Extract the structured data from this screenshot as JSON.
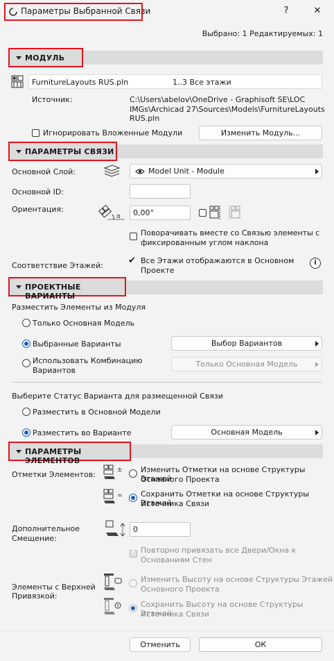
{
  "window": {
    "title": "Параметры Выбранной Связи",
    "help": "?",
    "close": "✕",
    "status": "Выбрано: 1 Редактируемых: 1"
  },
  "module": {
    "header": "МОДУЛЬ",
    "file_name": "FurnitureLayouts RUS.pln",
    "stories": "1..3 Все этажи",
    "source_label": "Источник:",
    "source_path_1": "C:\\Users\\abelov\\OneDrive - Graphisoft SE\\LOC",
    "source_path_2": "IMGs\\Archicad 27\\Sources\\Models\\FurnitureLayouts",
    "source_path_3": "RUS.pln",
    "ignore_nested": "Игнорировать Вложенные Модули",
    "change_module": "Изменить Модуль..."
  },
  "link": {
    "header": "ПАРАМЕТРЫ СВЯЗИ",
    "main_layer_label": "Основной Слой:",
    "main_layer_value": "Model Unit - Module",
    "main_id_label": "Основной ID:",
    "main_id_value": "",
    "orientation_label": "Ориентация:",
    "orientation_value": "0,00°",
    "rotate_fixed": "Поворачивать вместе со Связью элементы с",
    "rotate_fixed_2": "фиксированным углом наклона",
    "story_match_label": "Соответствие Этажей:",
    "story_match_1": "Все Этажи отображаются в Основном",
    "story_match_2": "Проекте",
    "info": "i"
  },
  "design_options": {
    "header": "ПРОЕКТНЫЕ ВАРИАНТЫ",
    "place_elements": "Разместить Элементы из Модуля",
    "only_main": "Только Основная Модель",
    "selected_options": "Выбранные Варианты",
    "select_options_btn": "Выбор Вариантов",
    "use_combination_1": "Использовать Комбинацию",
    "use_combination_2": "Вариантов",
    "combination_value": "Только Основная Модель",
    "choose_status": "Выберите Статус Варианта для размещенной Связи",
    "place_main": "Разместить в Основной Модели",
    "place_option": "Разместить во Варианте",
    "option_value": "Основная Модель"
  },
  "elements": {
    "header": "ПАРАМЕТРЫ ЭЛЕМЕНТОВ",
    "elevations_label": "Отметки Элементов:",
    "change_elev_1": "Изменить Отметки на основе Структуры Этажей",
    "change_elev_2": "Основного Проекта",
    "keep_elev_1": "Сохранить Отметки на основе Структуры Этажей",
    "keep_elev_2": "Источника Связи",
    "offset_label_1": "Дополнительное",
    "offset_label_2": "Смещение:",
    "offset_value": "0",
    "rebind_1": "Повторно привязать все Двери/Окна к",
    "rebind_2": "Основаниям Стен",
    "top_linked_1": "Элементы с Верхней",
    "top_linked_2": "Привязкой:",
    "change_height_1": "Изменить Высоту на основе Структуры Этажей",
    "change_height_2": "Основного Проекта",
    "keep_height_1": "Сохранить Высоту на основе Структуры Этажей",
    "keep_height_2": "Источника Связи"
  },
  "footer": {
    "cancel": "Отменить",
    "ok": "ОК"
  },
  "colors": {
    "highlight": "#e0141e",
    "accent": "#1a5fb4",
    "section_bg": "#dcdcdc"
  }
}
